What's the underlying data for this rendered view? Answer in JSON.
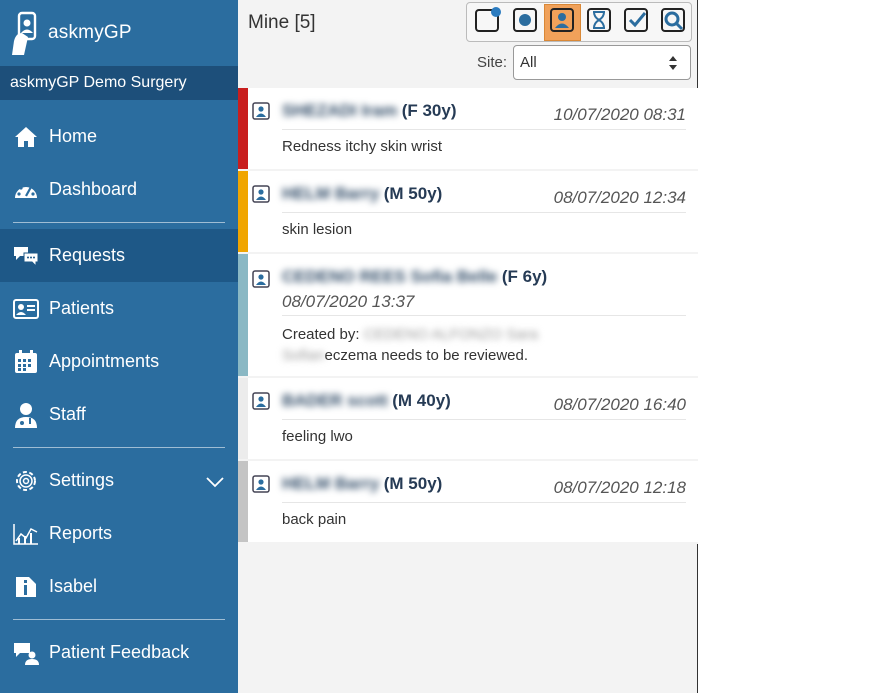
{
  "sidebar": {
    "brand": "askmyGP",
    "practice": "askmyGP Demo Surgery",
    "items": [
      {
        "label": "Home",
        "icon": "home-icon"
      },
      {
        "label": "Dashboard",
        "icon": "dashboard-gauge-icon"
      },
      {
        "label": "Requests",
        "icon": "chat-bubbles-icon"
      },
      {
        "label": "Patients",
        "icon": "id-card-icon"
      },
      {
        "label": "Appointments",
        "icon": "calendar-icon"
      },
      {
        "label": "Staff",
        "icon": "doctor-icon"
      },
      {
        "label": "Settings",
        "icon": "gear-icon"
      },
      {
        "label": "Reports",
        "icon": "chart-icon"
      },
      {
        "label": "Isabel",
        "icon": "isabel-icon"
      },
      {
        "label": "Patient Feedback",
        "icon": "feedback-icon"
      }
    ]
  },
  "header": {
    "title": "Mine [5]",
    "site_label": "Site:",
    "site_value": "All"
  },
  "toolbar": {
    "buttons": [
      "new-icon",
      "open-icon",
      "mine-icon",
      "waiting-icon",
      "completed-icon",
      "search-icon"
    ],
    "active": "mine-icon"
  },
  "requests": [
    {
      "name": "SHEZADI Iram",
      "meta": "(F 30y)",
      "time": "10/07/2020 08:31",
      "desc": "Redness itchy skin wrist",
      "color": "#c81e1e"
    },
    {
      "name": "HELM Barry",
      "meta": "(M 50y)",
      "time": "08/07/2020 12:34",
      "desc": "skin lesion",
      "color": "#f0a500"
    },
    {
      "name": "CEDENO REES Sofia Belle",
      "meta": "(F 6y)",
      "time": "08/07/2020 13:37",
      "created_by_label": "Created by:",
      "created_by": "CEDENO ALFONZO Sara Sofian",
      "desc": "eczema needs to be reviewed.",
      "color": "#8ab8c4"
    },
    {
      "name": "BADER scott",
      "meta": "(M 40y)",
      "time": "08/07/2020 16:40",
      "desc": "feeling lwo",
      "color": "#ececec"
    },
    {
      "name": "HELM Barry",
      "meta": "(M 50y)",
      "time": "08/07/2020 12:18",
      "desc": "back pain",
      "color": "#c4c4c4"
    }
  ]
}
